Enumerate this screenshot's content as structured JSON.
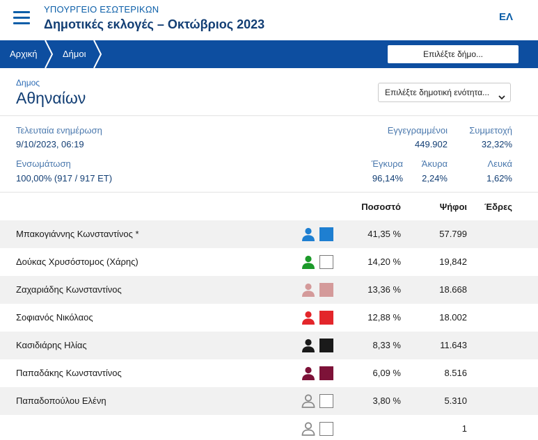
{
  "header": {
    "ministry": "ΥΠΟΥΡΓΕΙΟ ΕΣΩΤΕΡΙΚΩΝ",
    "title": "Δημοτικές εκλογές – Οκτώβριος 2023",
    "lang": "ΕΛ",
    "menu_icon": "hamburger-icon"
  },
  "breadcrumb": {
    "items": [
      "Αρχική",
      "Δήμοι"
    ],
    "municipality_select": "Επιλέξτε δήμο..."
  },
  "municipality": {
    "label": "Δημος",
    "name": "Αθηναίων",
    "unit_select": "Επιλέξτε δημοτική ενότητα..."
  },
  "stats": {
    "last_update_label": "Τελευταία ενημέρωση",
    "last_update_value": "9/10/2023, 06:19",
    "registered_label": "Εγγεγραμμένοι",
    "registered_value": "449.902",
    "turnout_label": "Συμμετοχή",
    "turnout_value": "32,32%",
    "integration_label": "Ενσωμάτωση",
    "integration_value": "100,00% (917 / 917 ΕΤ)",
    "valid_label": "Έγκυρα",
    "valid_value": "96,14%",
    "invalid_label": "Άκυρα",
    "invalid_value": "2,24%",
    "blank_label": "Λευκά",
    "blank_value": "1,62%"
  },
  "table": {
    "headers": {
      "percent": "Ποσοστό",
      "votes": "Ψήφοι",
      "seats": "Έδρες"
    },
    "rows": [
      {
        "name": "Μπακογιάννης Κωνσταντίνος *",
        "color": "#1e7fd1",
        "person_color": "#1e7fd1",
        "swatch": "filled",
        "percent": "41,35 %",
        "votes": "57.799"
      },
      {
        "name": "Δούκας Χρυσόστομος (Χάρης)",
        "color": "#ffffff",
        "person_color": "#1c9a2a",
        "swatch": "outline",
        "percent": "14,20 %",
        "votes": "19,842"
      },
      {
        "name": "Ζαχαριάδης Κωνσταντίνος",
        "color": "#d49a9a",
        "person_color": "#d49a9a",
        "swatch": "filled",
        "percent": "13,36 %",
        "votes": "18.668"
      },
      {
        "name": "Σοφιανός Νικόλαος",
        "color": "#e3262b",
        "person_color": "#e3262b",
        "swatch": "filled",
        "percent": "12,88 %",
        "votes": "18.002"
      },
      {
        "name": "Κασιδιάρης Ηλίας",
        "color": "#1a1a1a",
        "person_color": "#1a1a1a",
        "swatch": "filled",
        "percent": "8,33 %",
        "votes": "11.643"
      },
      {
        "name": "Παπαδάκης Κωνσταντίνος",
        "color": "#7d1238",
        "person_color": "#7d1238",
        "swatch": "filled",
        "percent": "6,09 %",
        "votes": "8.516"
      },
      {
        "name": "Παπαδοπούλου Ελένη",
        "color": "#ffffff",
        "person_color": "#8a8a8a",
        "swatch": "outline",
        "percent": "3,80 %",
        "votes": "5.310"
      },
      {
        "name": "",
        "color": "#ffffff",
        "person_color": "#8a8a8a",
        "swatch": "outline",
        "percent": "",
        "votes": "1"
      }
    ]
  }
}
